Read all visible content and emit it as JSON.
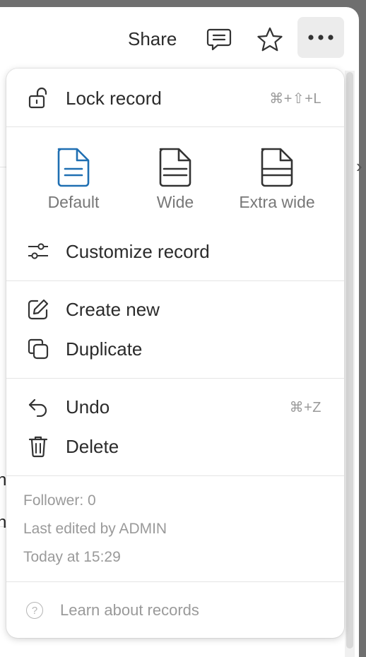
{
  "topbar": {
    "share_label": "Share",
    "icons": [
      "comment-icon",
      "star-icon",
      "more-icon"
    ]
  },
  "menu": {
    "lock": {
      "label": "Lock record",
      "shortcut": "⌘+⇧+L"
    },
    "layouts": [
      {
        "label": "Default",
        "selected": true
      },
      {
        "label": "Wide",
        "selected": false
      },
      {
        "label": "Extra wide",
        "selected": false
      }
    ],
    "customize": {
      "label": "Customize record"
    },
    "create_new": {
      "label": "Create new"
    },
    "duplicate": {
      "label": "Duplicate"
    },
    "undo": {
      "label": "Undo",
      "shortcut": "⌘+Z"
    },
    "delete": {
      "label": "Delete"
    },
    "info": {
      "follower": "Follower: 0",
      "last_edited": "Last edited by ADMIN",
      "edited_time": "Today at 15:29"
    },
    "learn": {
      "label": "Learn about records"
    }
  },
  "colors": {
    "accent": "#1f6fb2",
    "text": "#2b2b2b",
    "muted": "#9a9a9a"
  }
}
